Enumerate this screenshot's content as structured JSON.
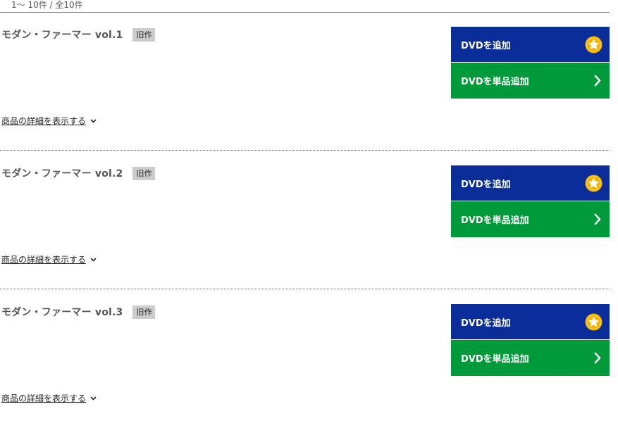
{
  "result_count": "1～ 10件 / 全10件",
  "colors": {
    "add_button_bg": "#0a2d9a",
    "single_button_bg": "#009a3a",
    "star_color": "#f5b400",
    "badge_bg": "#cccccc"
  },
  "items": [
    {
      "title": "モダン・ファーマー vol.1",
      "badge": "旧作",
      "add_label": "DVDを追加",
      "add_icon": "star-icon",
      "single_label": "DVDを単品追加",
      "single_icon": "chevron-right-icon",
      "detail_label": "商品の詳細を表示する"
    },
    {
      "title": "モダン・ファーマー vol.2",
      "badge": "旧作",
      "add_label": "DVDを追加",
      "add_icon": "star-icon",
      "single_label": "DVDを単品追加",
      "single_icon": "chevron-right-icon",
      "detail_label": "商品の詳細を表示する"
    },
    {
      "title": "モダン・ファーマー vol.3",
      "badge": "旧作",
      "add_label": "DVDを追加",
      "add_icon": "star-icon",
      "single_label": "DVDを単品追加",
      "single_icon": "chevron-right-icon",
      "detail_label": "商品の詳細を表示する"
    }
  ]
}
